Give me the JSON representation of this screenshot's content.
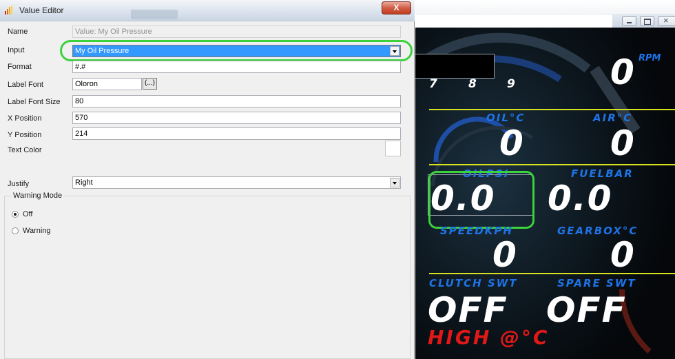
{
  "editor": {
    "title": "Value Editor",
    "close_glyph": "X",
    "fields": {
      "name": {
        "label": "Name",
        "value": "Value: My Oil Pressure"
      },
      "input": {
        "label": "Input",
        "value": "My Oil Pressure"
      },
      "format": {
        "label": "Format",
        "value": "#.#"
      },
      "label_font": {
        "label": "Label Font",
        "value": "Oloron",
        "button": "(...)"
      },
      "label_font_size": {
        "label": "Label Font Size",
        "value": "80"
      },
      "x_position": {
        "label": "X Position",
        "value": "570"
      },
      "y_position": {
        "label": "Y Position",
        "value": "214"
      },
      "text_color": {
        "label": "Text Color",
        "color": "#ffffff"
      },
      "justify": {
        "label": "Justify",
        "value": "Right"
      }
    },
    "warning_mode": {
      "legend": "Warning Mode",
      "options": [
        "Off",
        "Warning"
      ],
      "selected": "Off"
    }
  },
  "dash": {
    "rpm_value": "0",
    "rpm_unit": "RPM",
    "gear_ticks": [
      "7",
      "8",
      "9"
    ],
    "gauges": [
      {
        "label": "OIL°C",
        "value": "0"
      },
      {
        "label": "AIR°C",
        "value": "0"
      },
      {
        "label": "OILPSI",
        "value": "0.0"
      },
      {
        "label": "FUELBAR",
        "value": "0.0"
      },
      {
        "label": "SPEEDKPH",
        "value": "0"
      },
      {
        "label": "GEARBOX°C",
        "value": "0"
      },
      {
        "label": "CLUTCH SWT",
        "value": "OFF"
      },
      {
        "label": "SPARE SWT",
        "value": "OFF"
      }
    ],
    "warning_text": "HIGH @°C",
    "colors": {
      "label_blue": "#1e73e6",
      "divider_yellow": "#d8e21e",
      "warning_red": "#e01818",
      "highlight_green": "#3cd23c"
    }
  }
}
